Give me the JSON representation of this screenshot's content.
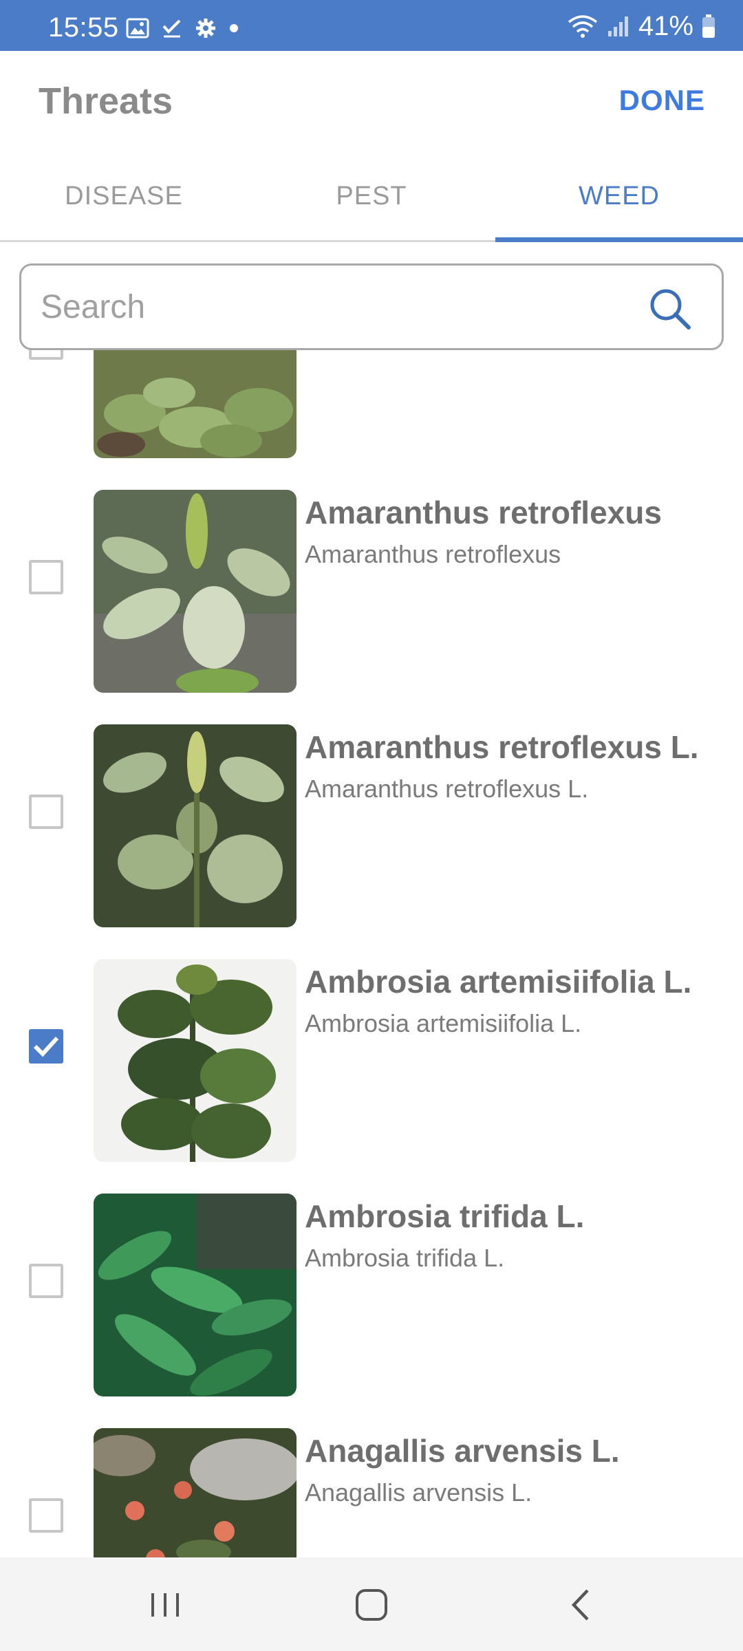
{
  "status_bar": {
    "time": "15:55",
    "battery": "41%",
    "icons": [
      "gallery-icon",
      "check-icon",
      "gear-icon",
      "dot-icon",
      "wifi-icon",
      "signal-icon",
      "battery-icon"
    ]
  },
  "header": {
    "title": "Threats",
    "done_label": "DONE"
  },
  "tabs": [
    {
      "label": "DISEASE",
      "active": false
    },
    {
      "label": "PEST",
      "active": false
    },
    {
      "label": "WEED",
      "active": true
    }
  ],
  "search": {
    "placeholder": "Search",
    "value": ""
  },
  "items": [
    {
      "title": "",
      "subtitle": "",
      "checked": false,
      "partial": true
    },
    {
      "title": "Amaranthus retroflexus",
      "subtitle": "Amaranthus retroflexus",
      "checked": false
    },
    {
      "title": "Amaranthus retroflexus L.",
      "subtitle": "Amaranthus retroflexus L.",
      "checked": false
    },
    {
      "title": "Ambrosia artemisiifolia L.",
      "subtitle": "Ambrosia artemisiifolia L.",
      "checked": true
    },
    {
      "title": "Ambrosia trifida L.",
      "subtitle": "Ambrosia trifida L.",
      "checked": false
    },
    {
      "title": "Anagallis arvensis L.",
      "subtitle": "Anagallis arvensis L.",
      "checked": false
    }
  ],
  "nav_bar": {
    "buttons": [
      "recents-icon",
      "home-icon",
      "back-icon"
    ]
  },
  "colors": {
    "accent": "#4a7cc8",
    "done": "#3e7be0",
    "status_bar": "#4a7cc8"
  }
}
